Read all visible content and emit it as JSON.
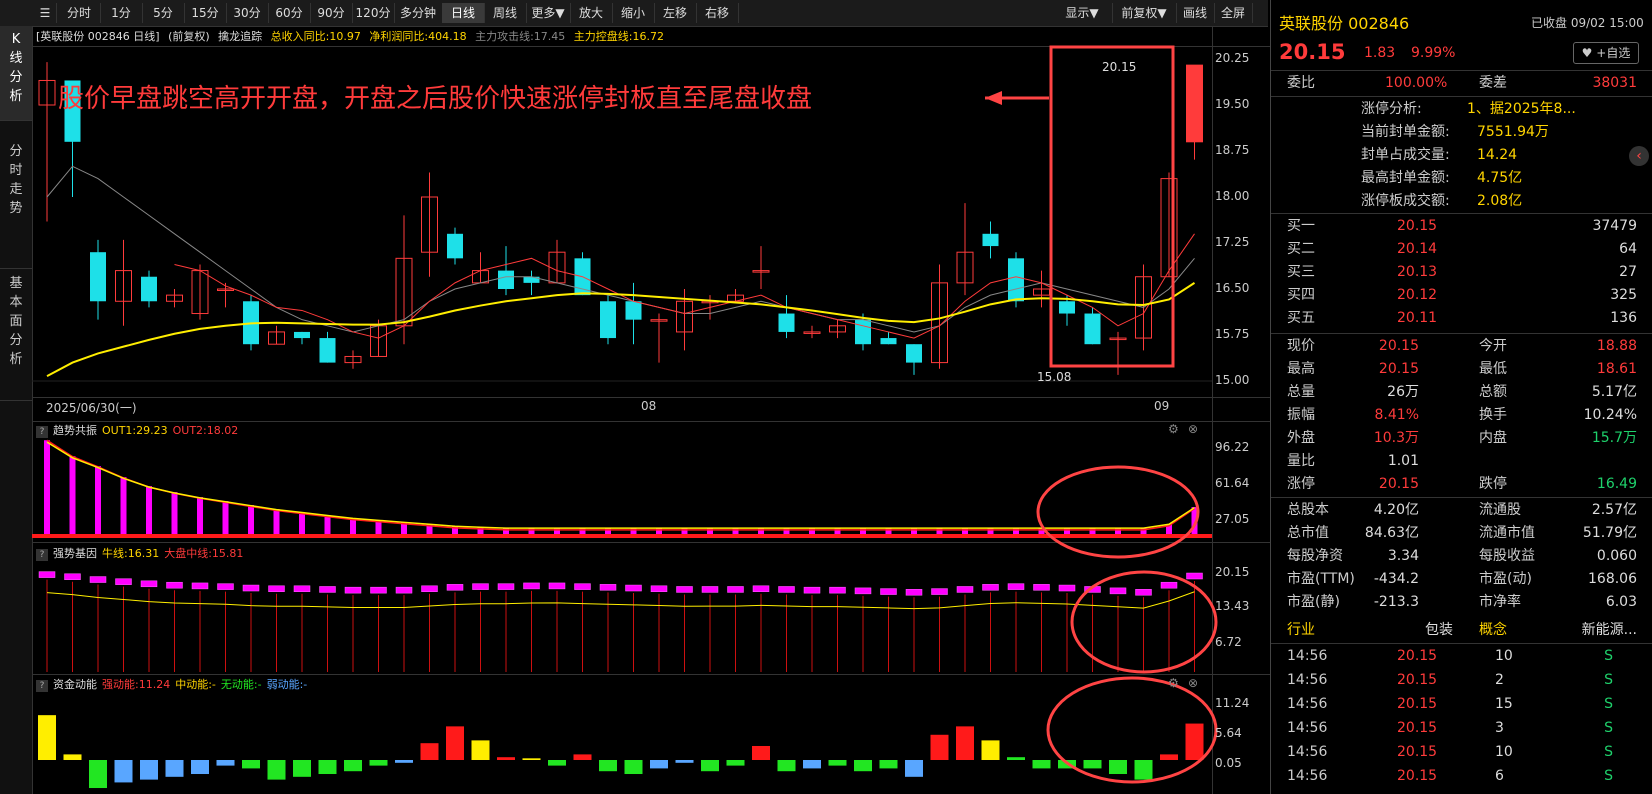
{
  "toolbar": {
    "periods": [
      "分时",
      "1分",
      "5分",
      "15分",
      "30分",
      "60分",
      "90分",
      "120分",
      "多分钟",
      "日线",
      "周线",
      "更多▼",
      "放大",
      "缩小",
      "左移",
      "右移"
    ],
    "right": [
      "显示▼",
      "前复权▼",
      "画线",
      "全屏"
    ],
    "active": "日线"
  },
  "sidebar": {
    "tabs": [
      "K线分析",
      "分时走势",
      "基本面分析"
    ]
  },
  "main": {
    "title": "[英联股份 002846 日线]",
    "adjust": "(前复权)",
    "indicator": "擒龙追踪",
    "ind_items": [
      "总收入同比:10.97",
      "净利润同比:404.18",
      "主力攻击线:17.45",
      "主力控盘线:16.72"
    ],
    "annotation": "股价早盘跳空高开开盘，开盘之后股价快速涨停封板直至尾盘收盘",
    "high_label": "20.15",
    "low_label": "15.08",
    "price_ticks": [
      "20.25",
      "19.50",
      "18.75",
      "18.00",
      "17.25",
      "16.50",
      "15.75",
      "15.00"
    ],
    "date_labels": [
      "2025/06/30(一)",
      "08",
      "09"
    ]
  },
  "panels": [
    {
      "name": "趋势共振",
      "items": [
        "OUT1:29.23",
        "OUT2:18.02"
      ],
      "ticks": [
        "96.22",
        "61.64",
        "27.05"
      ]
    },
    {
      "name": "强势基因",
      "items": [
        "牛线:16.31",
        "大盘中线:15.81"
      ],
      "ticks": [
        "20.15",
        "13.43",
        "6.72"
      ]
    },
    {
      "name": "资金动能",
      "items": [
        "强动能:11.24",
        "中动能:-",
        "无动能:-",
        "弱动能:-"
      ],
      "ticks": [
        "11.24",
        "5.64",
        "0.05"
      ]
    }
  ],
  "colors": {
    "up": "#ff3b3b",
    "down": "#1ee0e8",
    "ma": "#ffee00",
    "accent": "#ff4444"
  },
  "chart_data": {
    "type": "candlestick",
    "candles": [
      [
        19.5,
        19.9,
        20.2,
        17.6
      ],
      [
        19.9,
        18.9,
        19.0,
        18.0
      ],
      [
        17.1,
        16.3,
        17.3,
        16.0
      ],
      [
        16.3,
        16.8,
        17.3,
        15.9
      ],
      [
        16.7,
        16.3,
        16.8,
        16.2
      ],
      [
        16.3,
        16.4,
        16.5,
        16.2
      ],
      [
        16.1,
        16.8,
        16.9,
        16.0
      ],
      [
        16.5,
        16.5,
        16.6,
        16.2
      ],
      [
        16.3,
        15.6,
        16.4,
        15.5
      ],
      [
        15.6,
        15.8,
        15.9,
        15.6
      ],
      [
        15.8,
        15.7,
        15.8,
        15.6
      ],
      [
        15.7,
        15.3,
        15.8,
        15.3
      ],
      [
        15.3,
        15.4,
        15.5,
        15.2
      ],
      [
        15.4,
        15.9,
        16.0,
        15.4
      ],
      [
        15.9,
        17.0,
        17.7,
        15.6
      ],
      [
        17.1,
        18.0,
        18.4,
        16.7
      ],
      [
        17.4,
        17.0,
        17.5,
        16.9
      ],
      [
        16.6,
        16.8,
        17.1,
        16.6
      ],
      [
        16.8,
        16.5,
        17.2,
        16.4
      ],
      [
        16.7,
        16.6,
        16.8,
        16.4
      ],
      [
        16.6,
        17.1,
        17.3,
        16.6
      ],
      [
        17.0,
        16.4,
        17.1,
        16.4
      ],
      [
        16.3,
        15.7,
        16.4,
        15.6
      ],
      [
        16.3,
        16.0,
        16.6,
        15.6
      ],
      [
        16.0,
        16.0,
        16.1,
        15.3
      ],
      [
        15.8,
        16.3,
        16.5,
        15.5
      ],
      [
        16.3,
        16.3,
        16.4,
        16.0
      ],
      [
        16.3,
        16.4,
        16.5,
        16.3
      ],
      [
        16.8,
        16.8,
        17.2,
        16.5
      ],
      [
        16.1,
        15.8,
        16.4,
        15.7
      ],
      [
        15.8,
        15.8,
        15.9,
        15.7
      ],
      [
        15.8,
        15.9,
        16.0,
        15.7
      ],
      [
        16.0,
        15.6,
        16.1,
        15.5
      ],
      [
        15.7,
        15.6,
        15.8,
        15.6
      ],
      [
        15.6,
        15.3,
        15.6,
        15.1
      ],
      [
        15.3,
        16.6,
        16.9,
        15.2
      ],
      [
        16.6,
        17.1,
        17.9,
        16.4
      ],
      [
        17.4,
        17.2,
        17.6,
        17.0
      ],
      [
        17.0,
        16.3,
        17.1,
        16.2
      ],
      [
        16.4,
        16.5,
        16.8,
        16.2
      ],
      [
        16.3,
        16.1,
        16.4,
        15.9
      ],
      [
        16.1,
        15.6,
        16.2,
        15.6
      ],
      [
        15.7,
        15.7,
        15.8,
        15.1
      ],
      [
        15.7,
        16.7,
        16.9,
        15.5
      ],
      [
        16.7,
        18.3,
        18.4,
        16.7
      ],
      [
        18.9,
        20.15,
        20.15,
        18.61
      ]
    ],
    "ma_yellow": [
      15.08,
      15.3,
      15.45,
      15.56,
      15.67,
      15.77,
      15.85,
      15.9,
      15.94,
      15.95,
      15.94,
      15.93,
      15.92,
      15.92,
      15.96,
      16.05,
      16.15,
      16.23,
      16.3,
      16.35,
      16.4,
      16.43,
      16.42,
      16.4,
      16.37,
      16.34,
      16.31,
      16.28,
      16.25,
      16.2,
      16.15,
      16.09,
      16.03,
      15.98,
      15.96,
      16.02,
      16.13,
      16.25,
      16.33,
      16.35,
      16.34,
      16.3,
      16.25,
      16.24,
      16.33,
      16.6
    ],
    "ma_red": [
      null,
      null,
      null,
      null,
      null,
      16.9,
      16.8,
      16.55,
      16.4,
      16.2,
      16.15,
      16.0,
      15.8,
      15.7,
      15.9,
      16.3,
      16.6,
      16.8,
      16.9,
      17.0,
      16.8,
      16.7,
      16.5,
      16.3,
      16.2,
      16.1,
      16.2,
      16.3,
      16.4,
      16.2,
      16.1,
      16.0,
      15.9,
      15.8,
      15.7,
      15.9,
      16.3,
      16.6,
      16.7,
      16.6,
      16.4,
      16.2,
      15.9,
      16.1,
      16.8,
      17.4
    ],
    "ma_grey": [
      18.0,
      18.5,
      18.3,
      18.0,
      17.7,
      17.4,
      17.1,
      16.8,
      16.5,
      16.2,
      16.0,
      15.9,
      15.8,
      15.9,
      16.0,
      16.3,
      16.5,
      16.6,
      16.7,
      16.7,
      16.6,
      16.5,
      16.4,
      16.3,
      16.2,
      16.1,
      16.1,
      16.2,
      16.3,
      16.2,
      16.1,
      16.0,
      16.0,
      15.9,
      15.8,
      15.9,
      16.2,
      16.4,
      16.5,
      16.6,
      16.5,
      16.4,
      16.3,
      16.2,
      16.5,
      17.0
    ],
    "trend_bars": [
      96,
      80,
      70,
      59,
      50,
      44,
      39,
      35,
      31,
      27,
      24,
      21,
      18,
      16,
      14,
      12,
      10,
      9,
      8,
      8,
      8,
      8,
      8,
      8,
      8,
      8,
      8,
      8,
      8,
      8,
      8,
      8,
      8,
      8,
      8,
      8,
      8,
      8,
      8,
      8,
      8,
      8,
      8,
      8,
      12,
      29
    ],
    "strong_boxes": [
      19.5,
      19.2,
      18.8,
      18.5,
      18.2,
      18.0,
      17.9,
      17.8,
      17.6,
      17.5,
      17.5,
      17.4,
      17.3,
      17.3,
      17.3,
      17.5,
      17.7,
      17.8,
      17.8,
      17.9,
      17.9,
      17.8,
      17.7,
      17.6,
      17.5,
      17.4,
      17.4,
      17.4,
      17.5,
      17.4,
      17.3,
      17.3,
      17.2,
      17.1,
      17.0,
      17.1,
      17.4,
      17.7,
      17.8,
      17.7,
      17.6,
      17.4,
      17.2,
      17.0,
      18.0,
      19.3
    ],
    "fund_bars": [
      8.0,
      1.0,
      -5.0,
      -4.0,
      -3.5,
      -3.0,
      -2.5,
      -1.0,
      -1.5,
      -3.5,
      -3.0,
      -2.5,
      -2.0,
      -1.0,
      -0.5,
      3.0,
      6.0,
      3.5,
      0.5,
      0.3,
      -1.0,
      1.0,
      -2.0,
      -2.5,
      -1.5,
      -0.5,
      -2.0,
      -1.0,
      2.5,
      -2.0,
      -1.5,
      -1.0,
      -2.0,
      -1.5,
      -3.0,
      4.5,
      6.0,
      3.5,
      0.5,
      -1.5,
      -1.5,
      -1.5,
      -2.5,
      -3.5,
      1.0,
      6.5,
      11.24
    ],
    "fund_colors": [
      "#ffee00",
      "#ffee00",
      "#22e622",
      "#59a6ff",
      "#59a6ff",
      "#59a6ff",
      "#59a6ff",
      "#59a6ff",
      "#22e622",
      "#22e622",
      "#22e622",
      "#22e622",
      "#22e622",
      "#22e622",
      "#59a6ff",
      "#ff1a1a",
      "#ff1a1a",
      "#ffee00",
      "#ff1a1a",
      "#ffee00",
      "#22e622",
      "#ff1a1a",
      "#22e622",
      "#22e622",
      "#59a6ff",
      "#59a6ff",
      "#22e622",
      "#22e622",
      "#ff1a1a",
      "#22e622",
      "#59a6ff",
      "#22e622",
      "#22e622",
      "#22e622",
      "#59a6ff",
      "#ff1a1a",
      "#ff1a1a",
      "#ffee00",
      "#22e622",
      "#22e622",
      "#22e622",
      "#22e622",
      "#22e622",
      "#22e622",
      "#ff1a1a",
      "#ff1a1a",
      "#ff1a1a"
    ]
  },
  "right": {
    "name": "英联股份",
    "code": "002846",
    "status": "已收盘 09/02 15:00",
    "price": "20.15",
    "change": "1.83",
    "pct": "9.99%",
    "watch": "+自选",
    "weibi_l": "委比",
    "weibi_v": "100.00%",
    "weicha_l": "委差",
    "weicha_v": "38031",
    "limit_rows": [
      [
        "涨停分析:",
        "1、据2025年8..."
      ],
      [
        "当前封单金额:",
        "7551.94万"
      ],
      [
        "封单占成交量:",
        "14.24"
      ],
      [
        "最高封单金额:",
        "4.75亿"
      ],
      [
        "涨停板成交额:",
        "2.08亿"
      ]
    ],
    "buys": [
      [
        "买一",
        "20.15",
        "37479"
      ],
      [
        "买二",
        "20.14",
        "64"
      ],
      [
        "买三",
        "20.13",
        "27"
      ],
      [
        "买四",
        "20.12",
        "325"
      ],
      [
        "买五",
        "20.11",
        "136"
      ]
    ],
    "stats": [
      [
        "现价",
        "20.15",
        "今开",
        "18.88"
      ],
      [
        "最高",
        "20.15",
        "最低",
        "18.61"
      ],
      [
        "总量",
        "26万",
        "总额",
        "5.17亿"
      ],
      [
        "振幅",
        "8.41%",
        "换手",
        "10.24%"
      ],
      [
        "外盘",
        "10.3万",
        "内盘",
        "15.7万"
      ],
      [
        "量比",
        "1.01",
        "",
        ""
      ],
      [
        "涨停",
        "20.15",
        "跌停",
        "16.49"
      ]
    ],
    "fund": [
      [
        "总股本",
        "4.20亿",
        "流通股",
        "2.57亿"
      ],
      [
        "总市值",
        "84.63亿",
        "流通市值",
        "51.79亿"
      ],
      [
        "每股净资",
        "3.34",
        "每股收益",
        "0.060"
      ],
      [
        "市盈(TTM)",
        "-434.2",
        "市盈(动)",
        "168.06"
      ],
      [
        "市盈(静)",
        "-213.3",
        "市净率",
        "6.03"
      ]
    ],
    "industry_l": "行业",
    "industry_v": "包装",
    "concept_l": "概念",
    "concept_v": "新能源...",
    "trades": [
      [
        "14:56",
        "20.15",
        "10",
        "S"
      ],
      [
        "14:56",
        "20.15",
        "2",
        "S"
      ],
      [
        "14:56",
        "20.15",
        "15",
        "S"
      ],
      [
        "14:56",
        "20.15",
        "3",
        "S"
      ],
      [
        "14:56",
        "20.15",
        "10",
        "S"
      ],
      [
        "14:56",
        "20.15",
        "6",
        "S"
      ]
    ]
  }
}
